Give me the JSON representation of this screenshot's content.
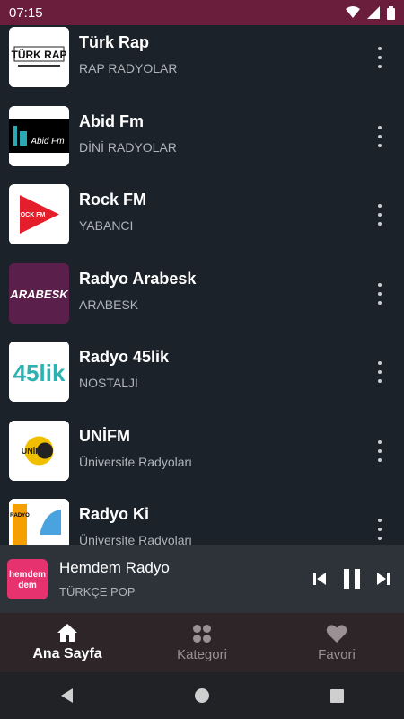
{
  "status": {
    "time": "07:15"
  },
  "stations": [
    {
      "name": "Türk Rap",
      "category": "RAP RADYOLAR",
      "logo_text": "TÜRK RAP"
    },
    {
      "name": "Abid Fm",
      "category": "DİNİ RADYOLAR",
      "logo_text": "Abid Fm"
    },
    {
      "name": "Rock FM",
      "category": "YABANCI",
      "logo_text": "ROCK FM"
    },
    {
      "name": "Radyo Arabesk",
      "category": "ARABESK",
      "logo_text": "ARABESK"
    },
    {
      "name": "Radyo 45lik",
      "category": "NOSTALJİ",
      "logo_text": "45lik"
    },
    {
      "name": "UNİFM",
      "category": "Üniversite Radyoları",
      "logo_text": "UNİFM"
    },
    {
      "name": "Radyo Ki",
      "category": "Üniversite Radyoları",
      "logo_text": "RADYO"
    }
  ],
  "now_playing": {
    "name": "Hemdem Radyo",
    "category": "TÜRKÇE POP",
    "logo_text": "hemdem"
  },
  "nav": {
    "home": "Ana Sayfa",
    "categories": "Kategori",
    "favorites": "Favori"
  },
  "colors": {
    "status_bar": "#6b1d3c",
    "background": "#1c2229",
    "player": "#2e3239",
    "nav": "#2e2529"
  }
}
